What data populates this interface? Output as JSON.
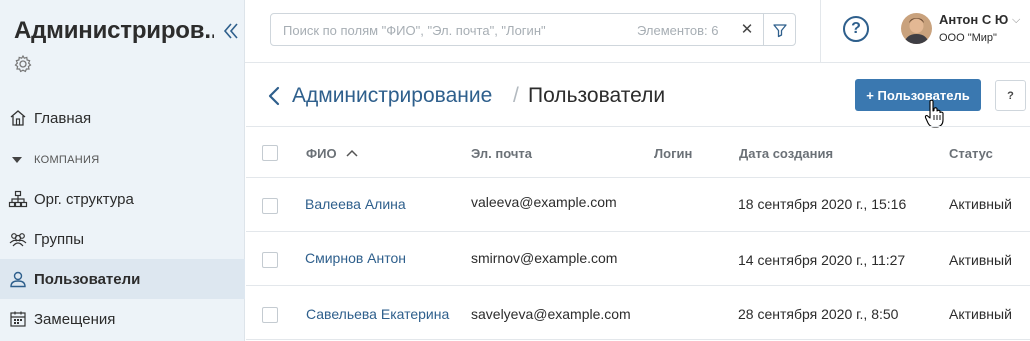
{
  "sidebar": {
    "title": "Администриров...",
    "items": [
      {
        "label": "Главная"
      },
      {
        "label": "Орг. структура"
      },
      {
        "label": "Группы"
      },
      {
        "label": "Пользователи"
      },
      {
        "label": "Замещения"
      }
    ],
    "section_label": "КОМПАНИЯ"
  },
  "topbar": {
    "search_placeholder": "Поиск по полям \"ФИО\", \"Эл. почта\", \"Логин\"",
    "search_count": "Элементов: 6",
    "help_label": "?",
    "user": {
      "name": "Антон С Ю",
      "org": "ООО \"Мир\""
    }
  },
  "header": {
    "breadcrumb_parent": "Администрирование",
    "breadcrumb_separator": "/",
    "breadcrumb_current": "Пользователи",
    "add_button_label": "+ Пользователь",
    "small_help_label": "?"
  },
  "table": {
    "columns": {
      "name": "ФИО",
      "email": "Эл. почта",
      "login": "Логин",
      "created": "Дата создания",
      "status": "Статус"
    },
    "rows": [
      {
        "name": "Валеева Алина",
        "email": "valeeva@example.com",
        "login": "",
        "created": "18 сентября 2020 г., 15:16",
        "status": "Активный"
      },
      {
        "name": "Смирнов Антон",
        "email": "smirnov@example.com",
        "login": "",
        "created": "14 сентября 2020 г., 11:27",
        "status": "Активный"
      },
      {
        "name": "Савельева Екатерина",
        "email": "savelyeva@example.com",
        "login": "",
        "created": "28 сентября 2020 г., 8:50",
        "status": "Активный"
      }
    ]
  },
  "colors": {
    "accent": "#2e5f8c",
    "primary_button": "#3a78b0",
    "sidebar_bg": "#edf3f8"
  }
}
